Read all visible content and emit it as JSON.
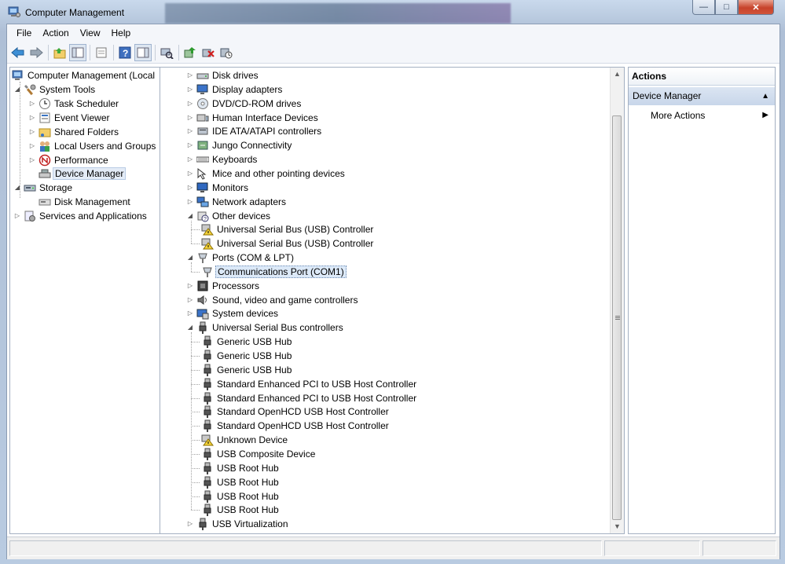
{
  "window": {
    "title": "Computer Management"
  },
  "menu": [
    "File",
    "Action",
    "View",
    "Help"
  ],
  "toolbar_icons": [
    "back-arrow-icon",
    "forward-arrow-icon",
    "up-folder-icon",
    "show-hide-tree-icon",
    "properties-icon",
    "help-icon",
    "action-pane-icon",
    "scan-hardware-icon",
    "update-driver-icon",
    "uninstall-icon",
    "disable-device-icon"
  ],
  "left_tree": [
    {
      "label": "Computer Management (Local"
    },
    {
      "label": "System Tools"
    },
    {
      "label": "Task Scheduler"
    },
    {
      "label": "Event Viewer"
    },
    {
      "label": "Shared Folders"
    },
    {
      "label": "Local Users and Groups"
    },
    {
      "label": "Performance"
    },
    {
      "label": "Device Manager"
    },
    {
      "label": "Storage"
    },
    {
      "label": "Disk Management"
    },
    {
      "label": "Services and Applications"
    }
  ],
  "device_tree": [
    {
      "label": "Disk drives"
    },
    {
      "label": "Display adapters"
    },
    {
      "label": "DVD/CD-ROM drives"
    },
    {
      "label": "Human Interface Devices"
    },
    {
      "label": "IDE ATA/ATAPI controllers"
    },
    {
      "label": "Jungo Connectivity"
    },
    {
      "label": "Keyboards"
    },
    {
      "label": "Mice and other pointing devices"
    },
    {
      "label": "Monitors"
    },
    {
      "label": "Network adapters"
    },
    {
      "label": "Other devices"
    },
    {
      "label": "Universal Serial Bus (USB) Controller"
    },
    {
      "label": "Universal Serial Bus (USB) Controller"
    },
    {
      "label": "Ports (COM & LPT)"
    },
    {
      "label": "Communications Port (COM1)"
    },
    {
      "label": "Processors"
    },
    {
      "label": "Sound, video and game controllers"
    },
    {
      "label": "System devices"
    },
    {
      "label": "Universal Serial Bus controllers"
    },
    {
      "label": "Generic USB Hub"
    },
    {
      "label": "Generic USB Hub"
    },
    {
      "label": "Generic USB Hub"
    },
    {
      "label": "Standard Enhanced PCI to USB Host Controller"
    },
    {
      "label": "Standard Enhanced PCI to USB Host Controller"
    },
    {
      "label": "Standard OpenHCD USB Host Controller"
    },
    {
      "label": "Standard OpenHCD USB Host Controller"
    },
    {
      "label": "Unknown Device"
    },
    {
      "label": "USB Composite Device"
    },
    {
      "label": "USB Root Hub"
    },
    {
      "label": "USB Root Hub"
    },
    {
      "label": "USB Root Hub"
    },
    {
      "label": "USB Root Hub"
    },
    {
      "label": "USB Virtualization"
    }
  ],
  "actions": {
    "header": "Actions",
    "section": "Device Manager",
    "item": "More Actions"
  },
  "colors": {
    "selection": "#e4ecf7",
    "action_section": "#c8d6ea"
  }
}
